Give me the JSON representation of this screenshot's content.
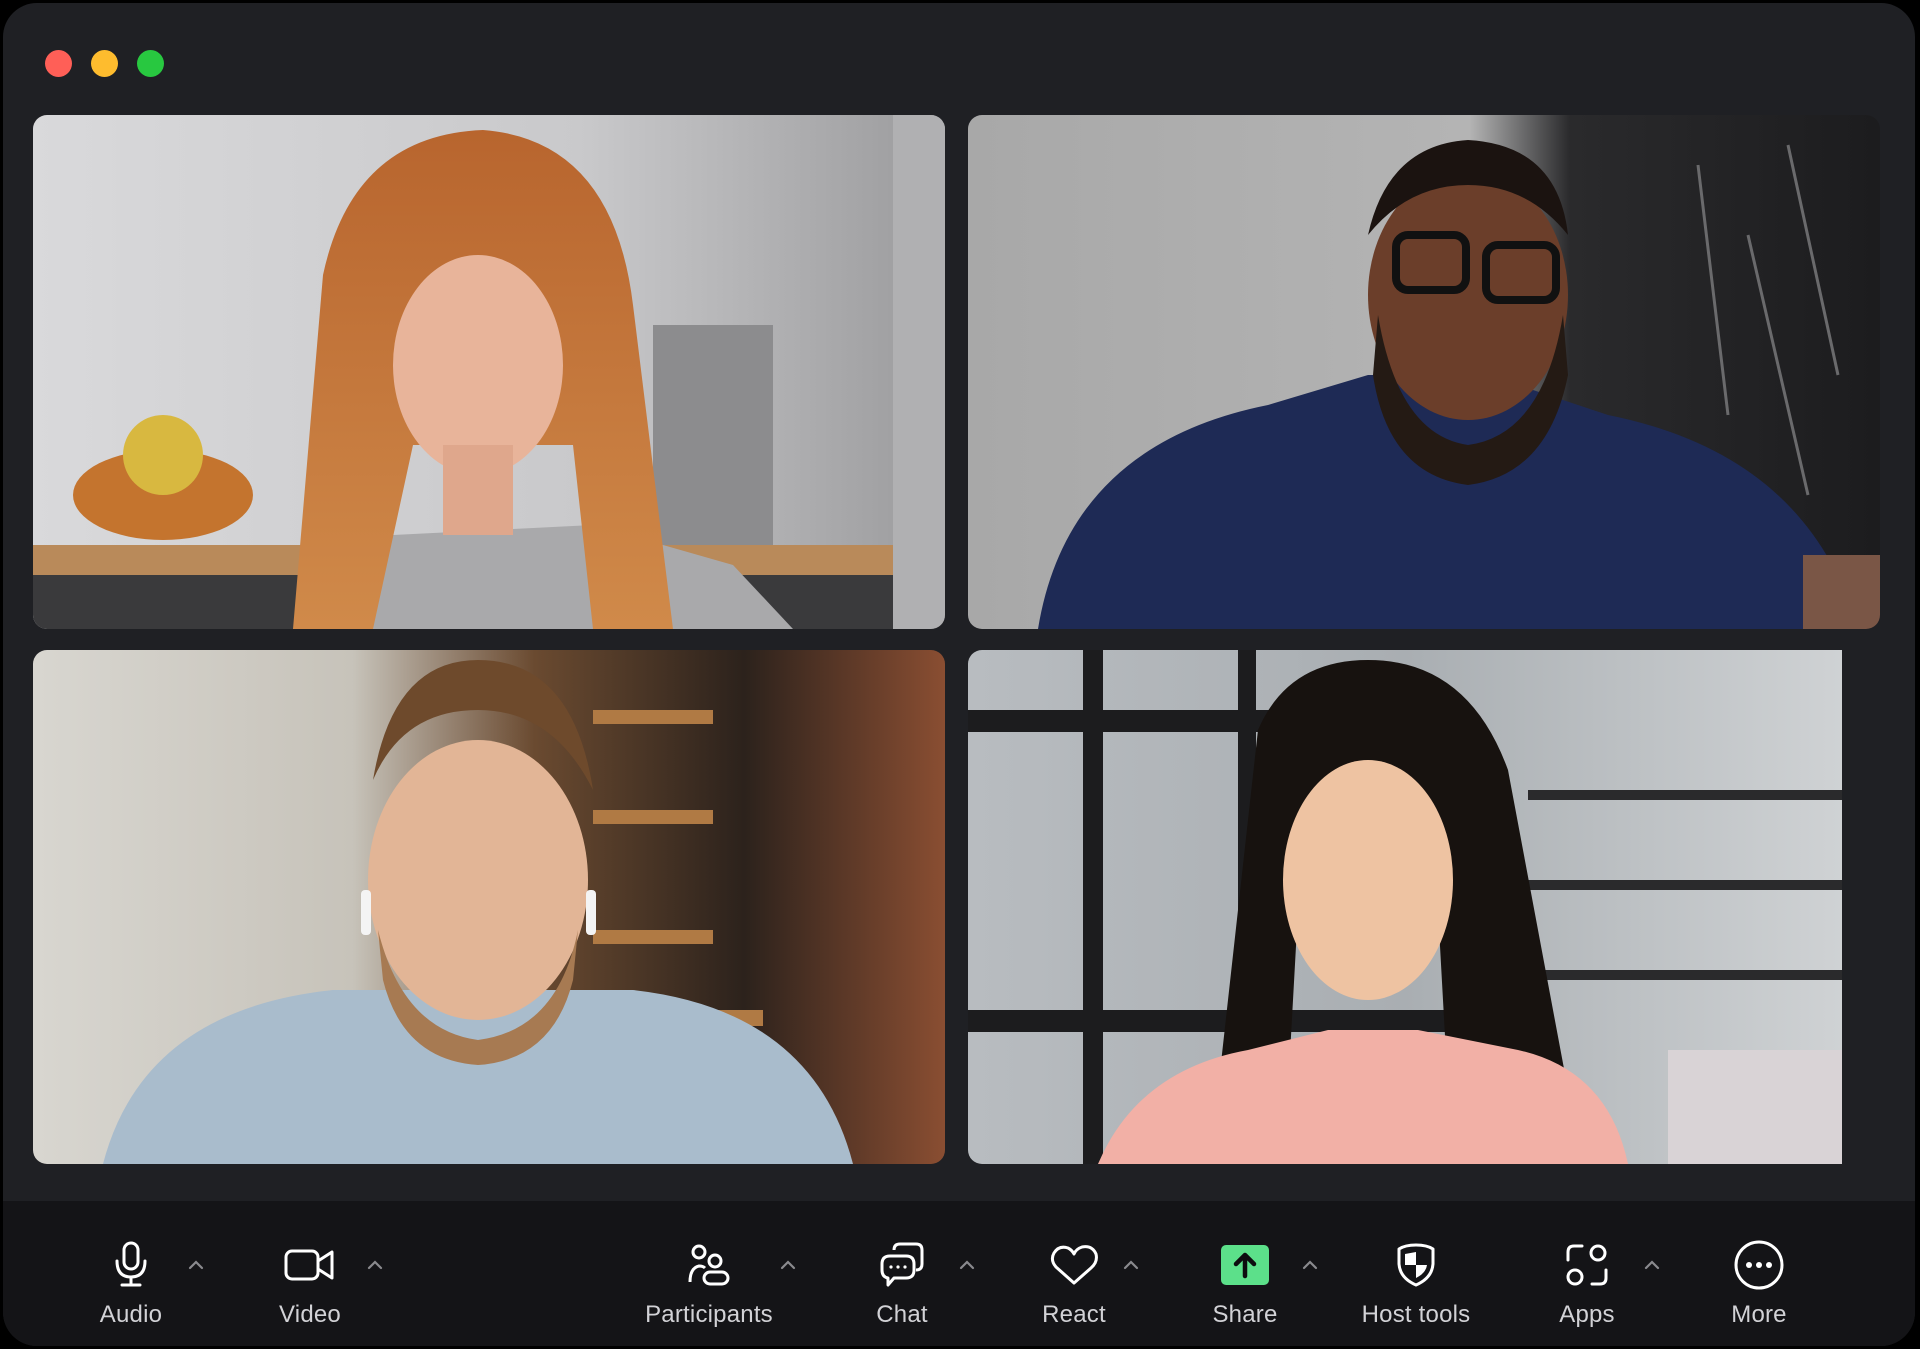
{
  "window": {
    "controls": [
      {
        "name": "close",
        "color": "#ff5f57"
      },
      {
        "name": "minimize",
        "color": "#febc2e"
      },
      {
        "name": "zoom",
        "color": "#28c840"
      }
    ]
  },
  "gallery": {
    "layout": "2x2 gallery view",
    "tiles": [
      {
        "description": "Woman with long red hair, grey t-shirt, kitchen background",
        "icon": "participant-video"
      },
      {
        "description": "Man with glasses and beard, navy turtleneck, marble wall background",
        "icon": "participant-video"
      },
      {
        "description": "Man with tied-back hair and earbuds, light blue shirt, brick wall background",
        "icon": "participant-video"
      },
      {
        "description": "Woman with long dark hair, pink t-shirt, shelving background",
        "icon": "participant-video"
      }
    ]
  },
  "toolbar": {
    "accent": "#5ce08a",
    "items": [
      {
        "id": "audio",
        "label": "Audio",
        "icon": "microphone-icon",
        "has_menu": true
      },
      {
        "id": "video",
        "label": "Video",
        "icon": "video-camera-icon",
        "has_menu": true
      },
      {
        "id": "participants",
        "label": "Participants",
        "icon": "participants-icon",
        "has_menu": true
      },
      {
        "id": "chat",
        "label": "Chat",
        "icon": "chat-bubbles-icon",
        "has_menu": true
      },
      {
        "id": "react",
        "label": "React",
        "icon": "heart-icon",
        "has_menu": true
      },
      {
        "id": "share",
        "label": "Share",
        "icon": "share-screen-arrow-icon",
        "has_menu": true
      },
      {
        "id": "host_tools",
        "label": "Host tools",
        "icon": "shield-icon",
        "has_menu": false
      },
      {
        "id": "apps",
        "label": "Apps",
        "icon": "apps-icon",
        "has_menu": true
      },
      {
        "id": "more",
        "label": "More",
        "icon": "more-dots-icon",
        "has_menu": false
      }
    ]
  }
}
